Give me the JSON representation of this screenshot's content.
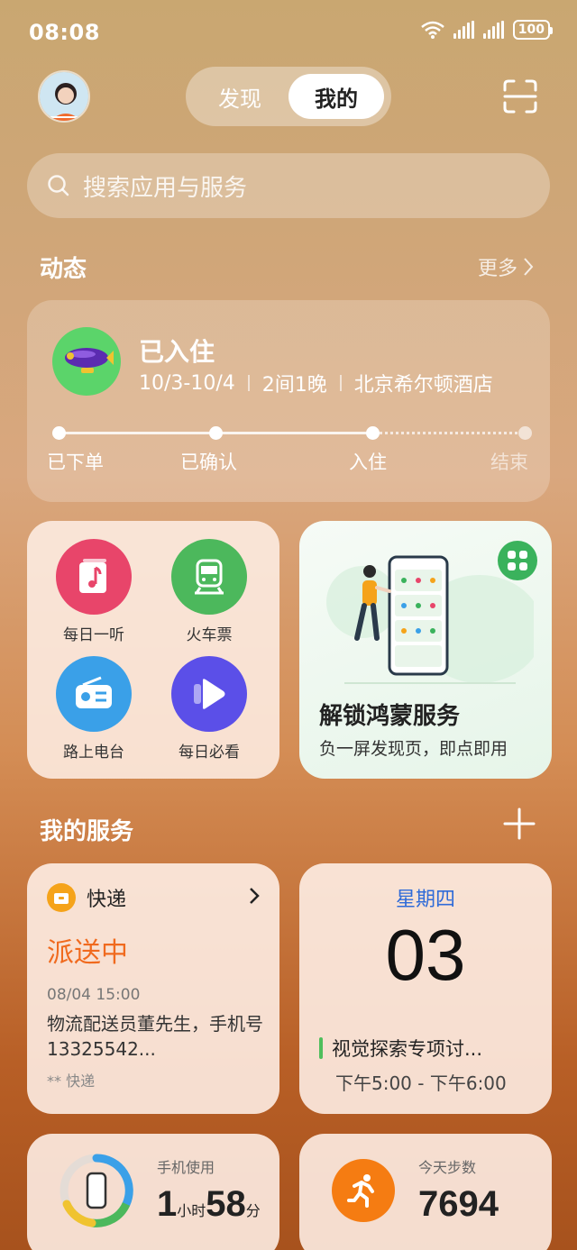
{
  "status": {
    "time": "08:08",
    "battery": "100"
  },
  "header": {
    "tabs": [
      {
        "label": "发现"
      },
      {
        "label": "我的"
      }
    ]
  },
  "search": {
    "placeholder": "搜索应用与服务"
  },
  "dynamics": {
    "title": "动态",
    "more": "更多",
    "trip": {
      "title": "已入住",
      "dates": "10/3-10/4",
      "rooms": "2间1晚",
      "hotel": "北京希尔顿酒店",
      "stages": [
        "已下单",
        "已确认",
        "入住",
        "结束"
      ]
    }
  },
  "apps": [
    {
      "label": "每日一听",
      "color": "#e8456a",
      "icon": "music-icon"
    },
    {
      "label": "火车票",
      "color": "#4cb85c",
      "icon": "train-icon"
    },
    {
      "label": "路上电台",
      "color": "#3aa0e8",
      "icon": "radio-icon"
    },
    {
      "label": "每日必看",
      "color": "#5b4fe8",
      "icon": "play-icon"
    }
  ],
  "promo": {
    "title": "解锁鸿蒙服务",
    "subtitle": "负一屏发现页，即点即用"
  },
  "services": {
    "title": "我的服务",
    "express": {
      "name": "快递",
      "status": "派送中",
      "time": "08/04  15:00",
      "desc": "物流配送员董先生，手机号13325542...",
      "source": "** 快递"
    },
    "calendar": {
      "weekday": "星期四",
      "day": "03",
      "event": "视觉探索专项讨...",
      "time": "下午5:00 - 下午6:00"
    },
    "usage": {
      "label": "手机使用",
      "hours": "1",
      "hours_unit": "小时",
      "minutes": "58",
      "minutes_unit": "分"
    },
    "steps": {
      "label": "今天步数",
      "value": "7694"
    }
  }
}
